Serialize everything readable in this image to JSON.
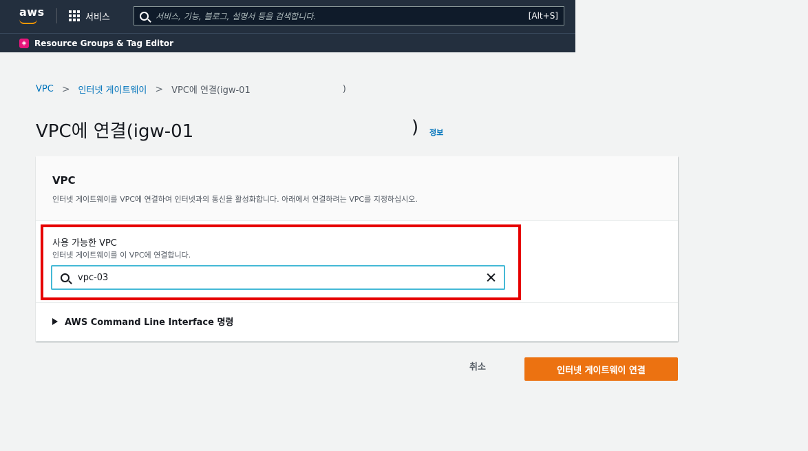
{
  "topnav": {
    "logo": "aws",
    "services_label": "서비스",
    "search_placeholder": "서비스, 기능, 블로그, 설명서 등을 검색합니다.",
    "search_shortcut": "[Alt+S]"
  },
  "subnav": {
    "icon": "resource-groups-icon",
    "label": "Resource Groups & Tag Editor"
  },
  "breadcrumb": {
    "items": [
      "VPC",
      "인터넷 게이트웨이",
      "VPC에 연결(igw-01"
    ],
    "close": ")"
  },
  "page": {
    "title": "VPC에 연결(igw-01",
    "title_close": ")",
    "info": "정보"
  },
  "card": {
    "title": "VPC",
    "description": "인터넷 게이트웨이를 VPC에 연결하여 인터넷과의 통신을 활성화합니다. 아래에서 연결하려는 VPC를 지정하십시오.",
    "field_label": "사용 가능한 VPC",
    "field_description": "인터넷 게이트웨이를 이 VPC에 연결합니다.",
    "field_value": "vpc-03",
    "cli_label": "AWS Command Line Interface 명령"
  },
  "actions": {
    "cancel": "취소",
    "primary": "인터넷 게이트웨이 연결"
  },
  "colors": {
    "nav_bg": "#232f3e",
    "link": "#0073bb",
    "primary": "#ec7211",
    "focus": "#44b9d6",
    "highlight": "#e60000"
  }
}
